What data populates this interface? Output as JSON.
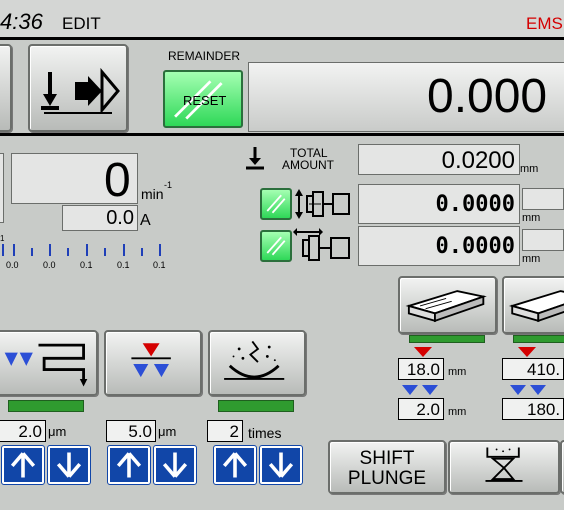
{
  "header": {
    "time": "4:36",
    "mode": "EDIT",
    "status": "EMS"
  },
  "remainder": {
    "label": "REMAINDER",
    "reset_label": "RESET",
    "value": "0.000"
  },
  "spindle": {
    "speed": "0",
    "speed_unit": "min",
    "speed_unit_sup": "-1",
    "current": "0.0",
    "current_unit": "A"
  },
  "scale": {
    "unit_fragment": "1",
    "ticks": [
      "0.0",
      "0.0",
      "0.1",
      "0.1",
      "0.1"
    ]
  },
  "total": {
    "label_line1": "TOTAL",
    "label_line2": "AMOUNT",
    "value": "0.0200",
    "unit": "mm"
  },
  "axes": [
    {
      "value": "0.0000",
      "unit": "mm"
    },
    {
      "value": "0.0000",
      "unit": "mm"
    }
  ],
  "params": [
    {
      "value": "18.0",
      "unit": "mm"
    },
    {
      "value": "2.0",
      "unit": "mm"
    },
    {
      "value": "410.",
      "unit": ""
    },
    {
      "value": "180.",
      "unit": ""
    }
  ],
  "cycle": [
    {
      "value": "2.0",
      "unit": "μm"
    },
    {
      "value": "5.0",
      "unit": "μm"
    },
    {
      "value": "2",
      "unit": "times"
    }
  ],
  "bottom": {
    "shift_plunge_line1": "SHIFT",
    "shift_plunge_line2": "PLUNGE"
  },
  "colors": {
    "accent_red": "#d40000",
    "arrow_blue": "#1146a8",
    "indicator_green": "#2f9b2f",
    "marker_blue": "#2c4fd6"
  }
}
